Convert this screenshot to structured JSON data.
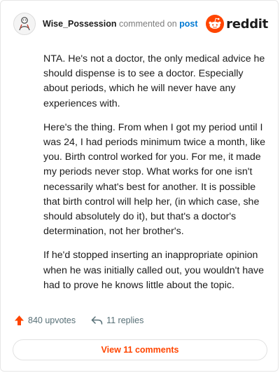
{
  "header": {
    "username": "Wise_Possession",
    "action": "commented on",
    "link_label": "post",
    "brand": "reddit",
    "avatar_icon": "user-avatar-icon",
    "brand_icon": "reddit-snoo-icon"
  },
  "comment": {
    "paragraphs": [
      "NTA. He's not a doctor, the only medical advice he should dispense is to see a doctor. Especially about periods, which he will never have any experiences with.",
      "Here's the thing. From when I got my period until I was 24, I had periods minimum twice a month, like you. Birth control worked for you. For me, it made my periods never stop. What works for one isn't necessarily what's best for another. It is possible that birth control will help her, (in which case, she should absolutely do it), but that's a doctor's determination, not her brother's.",
      "If he'd stopped inserting an inappropriate opinion when he was initially called out, you wouldn't have had to prove he knows little about the topic."
    ]
  },
  "stats": {
    "upvotes": "840 upvotes",
    "replies": "11 replies",
    "upvote_icon": "upvote-arrow-icon",
    "reply_icon": "reply-arrow-icon"
  },
  "view_button": {
    "label": "View 11 comments"
  },
  "colors": {
    "brand": "#ff4500",
    "link": "#0079d3",
    "muted": "#576f76",
    "text": "#1c1c1c"
  }
}
